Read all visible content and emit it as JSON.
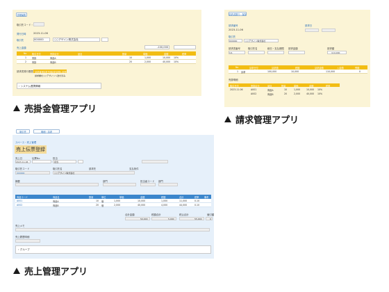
{
  "captions": {
    "sales_ar": "売掛金管理アプリ",
    "billing": "請求管理アプリ",
    "sales": "売上管理アプリ"
  },
  "shot1": {
    "top_btn": "詳細編集",
    "labels": [
      "取引先コード・番号",
      "発行日時",
      "取引先",
      "売上金額"
    ],
    "date": "2023-11-06",
    "client_code": "000000",
    "client_name": "○○デザイン株式会社",
    "amount": "-100,000",
    "table_headers": [
      "No",
      "取引日付",
      "売掛区分",
      "品目",
      "数量",
      "単価",
      "金額",
      "税率"
    ],
    "rows": [
      {
        "no": "1",
        "kind": "売掛",
        "item": "商品A",
        "qty": "10",
        "price": "1,000",
        "amount": "10,000",
        "tax": "10%"
      },
      {
        "no": "2",
        "kind": "売掛",
        "item": "商品B",
        "qty": "20",
        "price": "2,000",
        "amount": "40,000",
        "tax": "10%"
      }
    ],
    "section_label": "請求書発行履歴",
    "sub_headers": [
      "請求番号",
      "請求日時",
      "請求金額",
      "入金額"
    ],
    "sub_note": "請求書を○○デザインへ送付済み",
    "group_label": "› システム連携情報"
  },
  "shot2": {
    "top_btn": "請求書発行・保存",
    "labels": [
      "請求番号",
      "請求日",
      "取引先",
      "請求先"
    ],
    "date": "2023-11-06",
    "client_code": "000000",
    "client_name": "○○デザイン株式会社",
    "grid_labels": [
      "請求書番号",
      "取引先名",
      "締日・支払期限",
      "請求金額",
      "請求額"
    ],
    "grid_values": [
      "1/1",
      "110,000"
    ],
    "table_headers": [
      "No",
      "請求日付",
      "請求額",
      "税額",
      "請求金額",
      "入金額",
      "残額"
    ],
    "row": {
      "no": "1",
      "kind": "請求",
      "amount": "100,000",
      "tax": "10,000",
      "total": "110,000",
      "balance": "0"
    },
    "section_label": "売掛明細",
    "sub_headers": [
      "取引日付",
      "売掛区分",
      "品目",
      "数量",
      "単価",
      "金額",
      "税率"
    ],
    "sub_rows": [
      {
        "date": "2023-11-06",
        "kind": "A001",
        "item": "商品A",
        "qty": "10",
        "price": "1,000",
        "amount": "10,000",
        "tax": "10%"
      },
      {
        "date": "",
        "kind": "A002",
        "item": "商品B",
        "qty": "20",
        "price": "2,000",
        "amount": "40,000",
        "tax": "10%"
      }
    ]
  },
  "shot3": {
    "tabs": [
      "取引先",
      "明細・請求"
    ],
    "breadcrumb": "スペース・売上管理",
    "title": "売上伝票登録",
    "labels": [
      "売上日",
      "伝票No",
      "担当",
      "取引先コード",
      "取引先名",
      "請求先",
      "支払条件",
      "摘要",
      "部門",
      "担当者コード",
      "部門"
    ],
    "date": "2023-11-06",
    "rep": "担当",
    "client_code": "000000",
    "client_name": "○○デザイン株式会社",
    "table_headers": [
      "商品コード",
      "商品名",
      "数量",
      "単位",
      "単価",
      "金額",
      "税額",
      "合計",
      "税率",
      "備考"
    ],
    "rows": [
      {
        "code": "A001",
        "name": "商品A",
        "qty": "10",
        "unit": "個",
        "price": "1,000",
        "amount": "10,000",
        "tax": "1,000",
        "total": "11,000",
        "rate": "0.10"
      },
      {
        "code": "A002",
        "name": "商品B",
        "qty": "20",
        "unit": "個",
        "price": "2,000",
        "amount": "40,000",
        "tax": "4,000",
        "total": "44,000",
        "rate": "0.10"
      }
    ],
    "total_labels": [
      "合計金額",
      "税額合計",
      "税込合計",
      "値引額"
    ],
    "totals": [
      "50,000",
      "5,000",
      "55,000",
      "0"
    ],
    "memo_label": "売上メモ",
    "history_label": "売上履歴明細",
    "group_label": "› グループ"
  },
  "colors": {
    "yellow": "#f2bd13",
    "blue": "#3b86cc",
    "panel_yellow": "#fbf4d6",
    "panel_blue": "#e6f0fa"
  }
}
